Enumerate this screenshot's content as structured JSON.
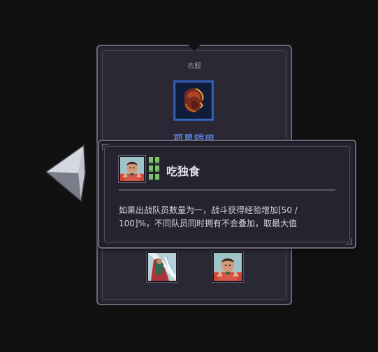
{
  "item_card": {
    "category": "衣服",
    "item_name": "孤星铠甲",
    "item_icon": "armor-icon",
    "crew_slots": [
      {
        "icon": "crew-portrait-icon"
      },
      {
        "icon": "crew-portrait-icon"
      }
    ]
  },
  "navigation": {
    "previous_icon": "arrow-left-icon"
  },
  "trait_tooltip": {
    "name": "吃独食",
    "portrait_icon": "crew-portrait-icon",
    "level_pips": 6,
    "description": "如果出战队员数量为一，战斗获得经验增加[50 / 100]%，不同队员同时拥有不会叠加，取最大值"
  },
  "colors": {
    "background": "#111111",
    "panel": "#2b2836",
    "panel_border": "#6e6678",
    "item_name": "#5a7fd8",
    "rarity_frame": "#2c58a8",
    "pip_green": "#7cc36a"
  }
}
